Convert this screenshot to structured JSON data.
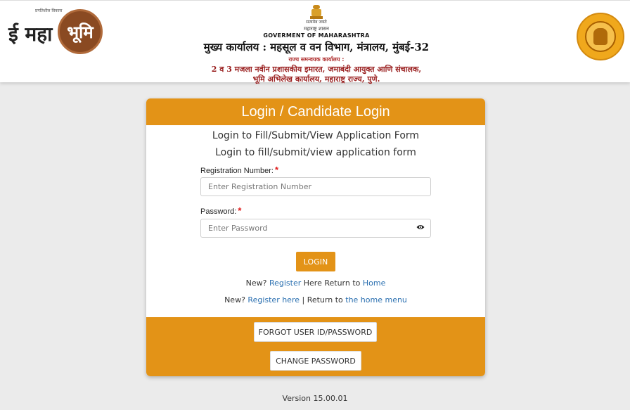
{
  "header": {
    "logo_left_tag": "प्रगतिशील विकास",
    "logo_left_prefix": "ई महा",
    "logo_left_circle": "भूमि",
    "satyamev": "सत्यमेव जयते",
    "shasan": "महाराष्ट्र शासन",
    "govt": "GOVERMENT OF MAHARASHTRA",
    "head_office": "मुख्य कार्यालय : महसूल व वन विभाग, मंत्रालय, मुंबई-32",
    "coordinator": "राज्य समन्वयक कार्यालय :",
    "address_line1": "2 व 3 मजला नवीन प्रशासकीय इमारत, जमाबंदी आयुक्त आणि संचालक,",
    "address_line2": "भूमि अभिलेख कार्यालय, महाराष्ट्र राज्य, पुणे."
  },
  "card": {
    "title": "Login / Candidate Login",
    "subtitle1": "Login to Fill/Submit/View Application Form",
    "subtitle2": "Login to fill/submit/view application form",
    "registration_label": "Registration Number:",
    "registration_placeholder": "Enter Registration Number",
    "password_label": "Password:",
    "password_placeholder": "Enter Password",
    "required_mark": "*",
    "login_button": "LOGIN",
    "line1": {
      "prefix": "New?",
      "register": "Register",
      "middle": "Here Return to",
      "home": "Home"
    },
    "line2": {
      "prefix": "New?",
      "register": "Register here",
      "middle": "| Return to",
      "home": "the home menu"
    },
    "forgot_button": "FORGOT USER ID/PASSWORD",
    "change_button": "CHANGE PASSWORD"
  },
  "version": "Version 15.00.01",
  "colors": {
    "accent": "#e39317",
    "link": "#2a6fb0",
    "required": "#e01b1b"
  }
}
